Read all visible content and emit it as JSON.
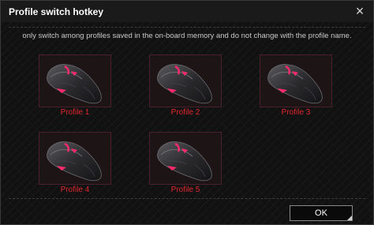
{
  "dialog": {
    "title": "Profile switch hotkey",
    "description": "only switch among profiles saved in the on-board memory and do not change with the profile name.",
    "ok_label": "OK"
  },
  "profiles": [
    {
      "label": "Profile 1"
    },
    {
      "label": "Profile 2"
    },
    {
      "label": "Profile 3"
    },
    {
      "label": "Profile 4"
    },
    {
      "label": "Profile 5"
    }
  ],
  "colors": {
    "accent": "#e0262e",
    "highlight": "#ff2a6d",
    "background": "#111111"
  },
  "icons": {
    "close": "close-icon",
    "mouse": "mouse-icon"
  }
}
